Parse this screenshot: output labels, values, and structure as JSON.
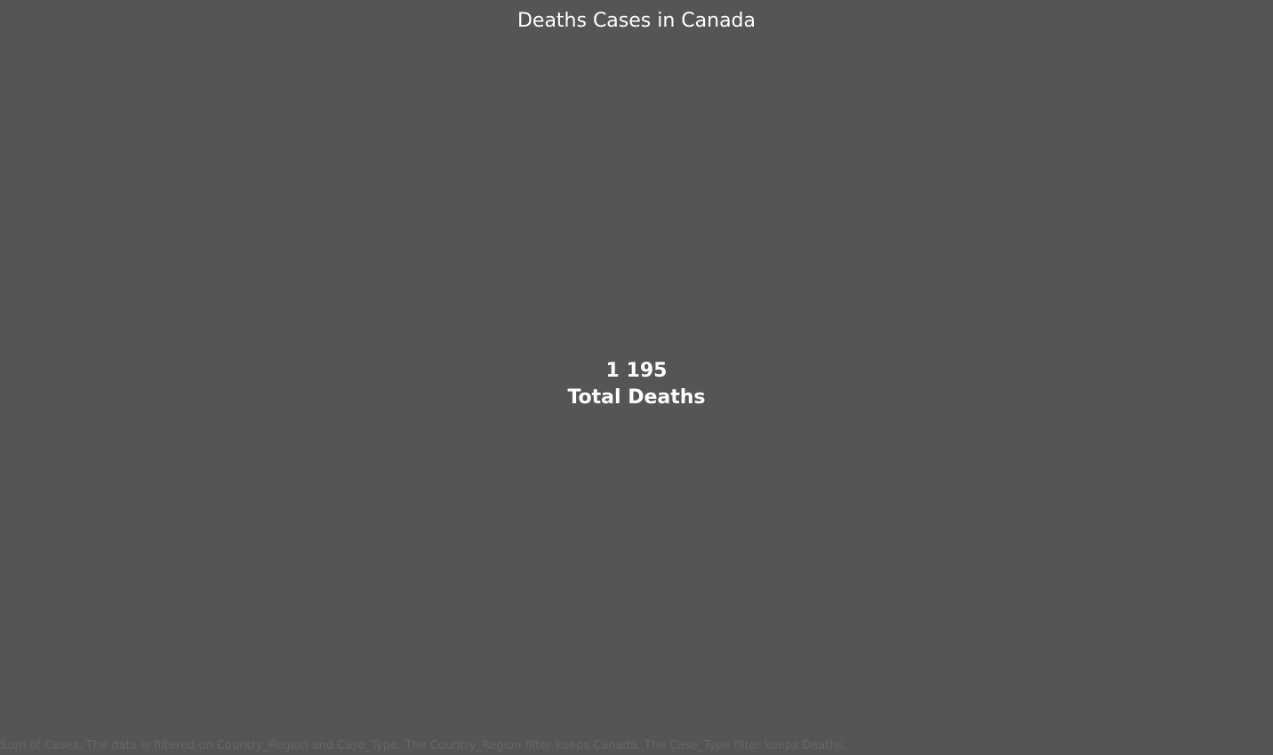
{
  "chart_data": {
    "type": "table",
    "title": "Deaths Cases in Canada",
    "values": [
      1195
    ],
    "value_label": "1 195",
    "measure_label": "Total Deaths",
    "caption": "Sum of Cases. The data is filtered on Country_Region and Case_Type. The Country_Region filter keeps Canada. The Case_Type filter keeps Deaths."
  },
  "colors": {
    "background": "#555555",
    "text": "#ffffff",
    "caption": "#656565"
  }
}
